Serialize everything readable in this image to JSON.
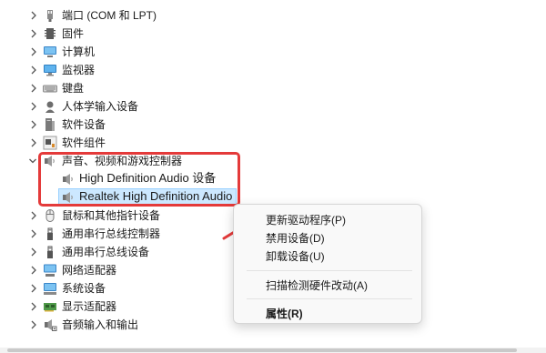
{
  "device_tree": {
    "items": [
      {
        "label": "端口 (COM 和 LPT)",
        "icon": "port-icon",
        "expanded": false
      },
      {
        "label": "固件",
        "icon": "firmware-icon",
        "expanded": false
      },
      {
        "label": "计算机",
        "icon": "computer-icon",
        "expanded": false
      },
      {
        "label": "监视器",
        "icon": "monitor-icon",
        "expanded": false
      },
      {
        "label": "键盘",
        "icon": "keyboard-icon",
        "expanded": false
      },
      {
        "label": "人体学输入设备",
        "icon": "hid-icon",
        "expanded": false
      },
      {
        "label": "软件设备",
        "icon": "software-device-icon",
        "expanded": false
      },
      {
        "label": "软件组件",
        "icon": "software-component-icon",
        "expanded": false
      },
      {
        "label": "声音、视频和游戏控制器",
        "icon": "speaker-icon",
        "expanded": true,
        "children": [
          {
            "label": "High Definition Audio 设备",
            "icon": "speaker-icon"
          },
          {
            "label": "Realtek High Definition Audio",
            "icon": "speaker-icon",
            "selected": true
          }
        ]
      },
      {
        "label": "鼠标和其他指针设备",
        "icon": "mouse-icon",
        "expanded": false
      },
      {
        "label": "通用串行总线控制器",
        "icon": "usb-icon",
        "expanded": false
      },
      {
        "label": "通用串行总线设备",
        "icon": "usb-icon",
        "expanded": false
      },
      {
        "label": "网络适配器",
        "icon": "network-icon",
        "expanded": false
      },
      {
        "label": "系统设备",
        "icon": "system-device-icon",
        "expanded": false
      },
      {
        "label": "显示适配器",
        "icon": "display-adapter-icon",
        "expanded": false
      },
      {
        "label": "音频输入和输出",
        "icon": "audio-io-icon",
        "expanded": false
      }
    ]
  },
  "context_menu": {
    "update_driver": "更新驱动程序(P)",
    "disable_device": "禁用设备(D)",
    "uninstall_device": "卸载设备(U)",
    "scan_hardware": "扫描检测硬件改动(A)",
    "properties": "属性(R)"
  },
  "colors": {
    "highlight_box": "#e43a3a",
    "arrow": "#e43a3a",
    "selection_bg": "#cce8ff"
  }
}
